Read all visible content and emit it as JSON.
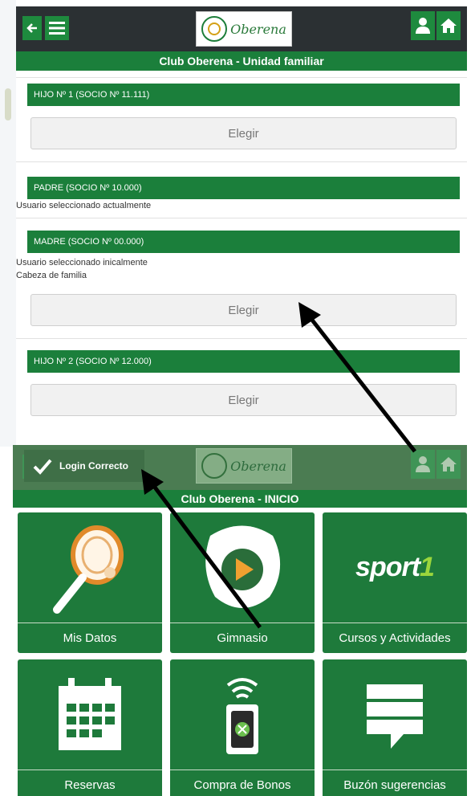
{
  "top": {
    "title": "Club Oberena - Unidad familiar",
    "logo_text": "Oberena",
    "members": [
      {
        "header": "HIJO Nº 1 (SOCIO Nº 11.111)",
        "notes": [],
        "button": "Elegir"
      },
      {
        "header": "PADRE (SOCIO Nº 10.000)",
        "notes": [
          "Usuario seleccionado actualmente"
        ],
        "button": ""
      },
      {
        "header": "MADRE (SOCIO Nº 00.000)",
        "notes": [
          "Usuario seleccionado inicalmente",
          "Cabeza de familia"
        ],
        "button": "Elegir"
      },
      {
        "header": "HIJO Nº 2 (SOCIO Nº 12.000)",
        "notes": [],
        "button": "Elegir"
      }
    ]
  },
  "bottom": {
    "title": "Club Oberena - INICIO",
    "logo_text": "Oberena",
    "toast": "Login Correcto",
    "tiles": [
      {
        "label": "Mis Datos",
        "icon": "racket-icon"
      },
      {
        "label": "Gimnasio",
        "icon": "play-icon"
      },
      {
        "label": "Cursos y Actividades",
        "icon": "sport1-logo"
      },
      {
        "label": "Reservas",
        "icon": "calendar-icon"
      },
      {
        "label": "Compra de Bonos",
        "icon": "nfc-card-icon"
      },
      {
        "label": "Buzón sugerencias",
        "icon": "message-icon"
      }
    ],
    "sport_logo": {
      "main": "sport",
      "accent": "1"
    }
  },
  "colors": {
    "green": "#1b7f3b",
    "dark_bar": "#2b3033",
    "accent_green": "#9bd63c"
  }
}
